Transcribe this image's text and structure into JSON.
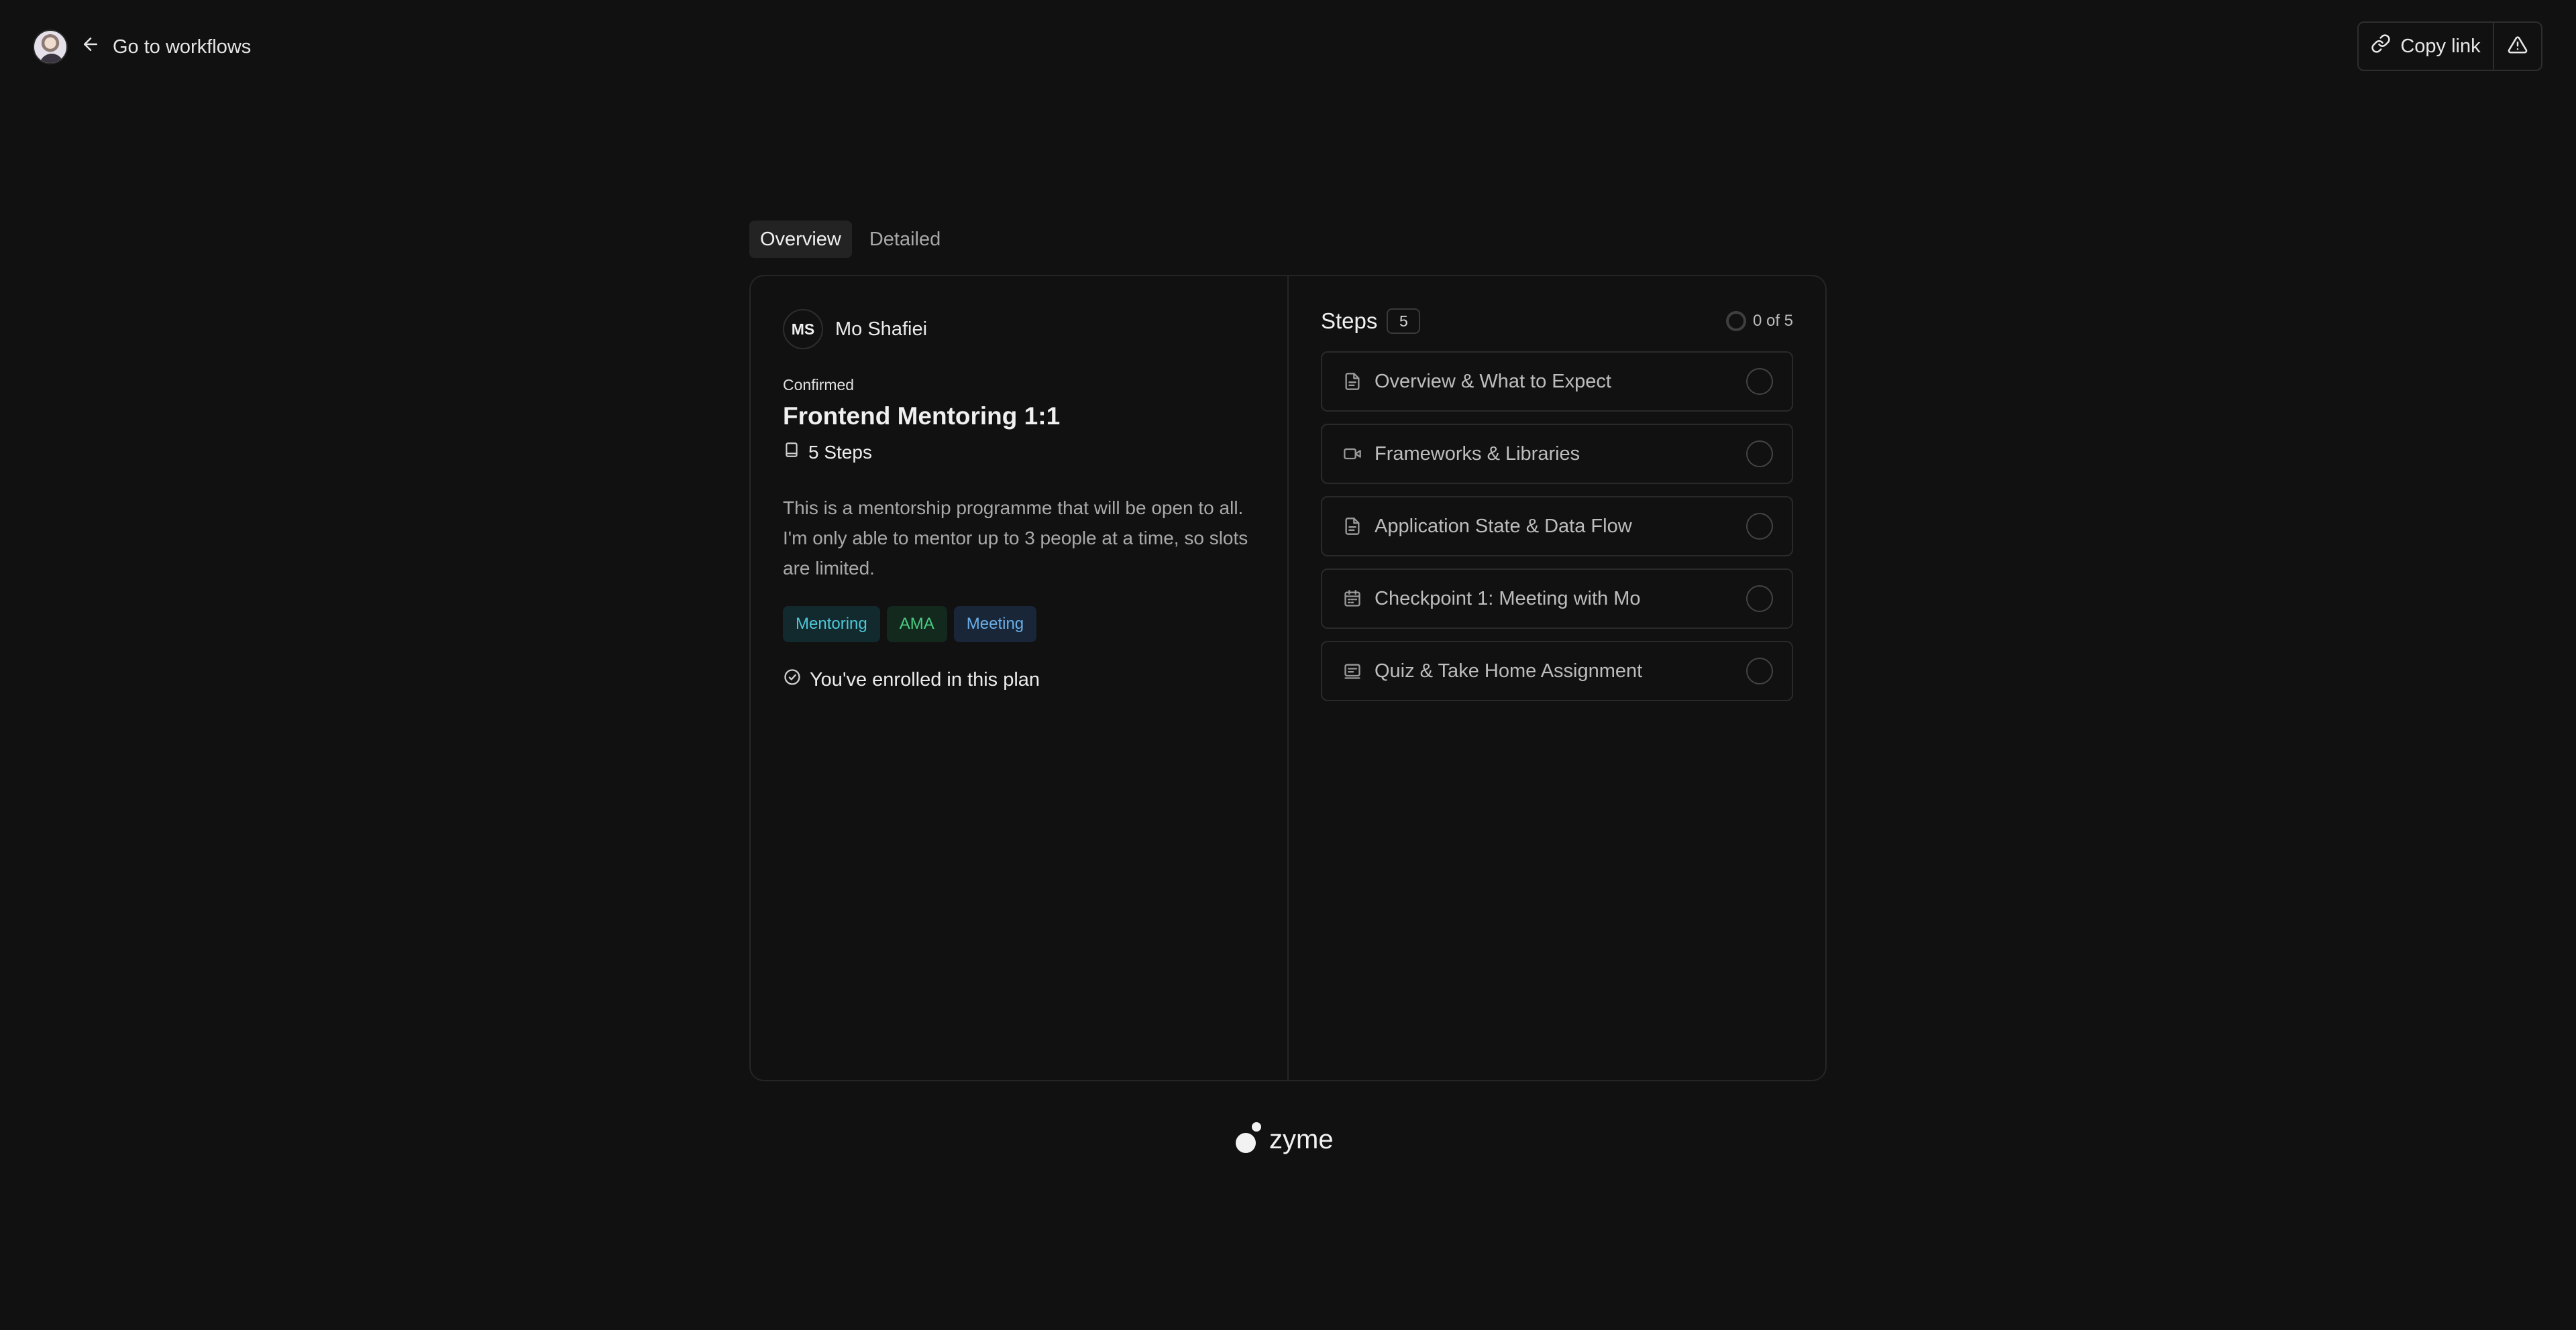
{
  "header": {
    "back_label": "Go to workflows",
    "copy_link_label": "Copy link"
  },
  "tabs": [
    {
      "label": "Overview",
      "active": true
    },
    {
      "label": "Detailed",
      "active": false
    }
  ],
  "plan": {
    "owner_initials": "MS",
    "owner_name": "Mo Shafiei",
    "status": "Confirmed",
    "title": "Frontend Mentoring 1:1",
    "steps_label": "5 Steps",
    "description": "This is a mentorship programme that will be open to all. I'm only able to mentor up to 3 people at a time, so slots are limited.",
    "tags": [
      {
        "label": "Mentoring",
        "color": "#4ec6d6"
      },
      {
        "label": "AMA",
        "color": "#49cf83"
      },
      {
        "label": "Meeting",
        "color": "#6aaee8"
      }
    ],
    "enrolled_label": "You've enrolled in this plan"
  },
  "steps_panel": {
    "title": "Steps",
    "count": "5",
    "progress": "0 of 5",
    "items": [
      {
        "label": "Overview & What to Expect",
        "icon": "document-icon"
      },
      {
        "label": "Frameworks & Libraries",
        "icon": "video-icon"
      },
      {
        "label": "Application State & Data Flow",
        "icon": "document-icon"
      },
      {
        "label": "Checkpoint 1: Meeting with Mo",
        "icon": "calendar-icon"
      },
      {
        "label": "Quiz & Take Home Assignment",
        "icon": "quiz-icon"
      }
    ]
  },
  "footer": {
    "logo_text": "zyme"
  }
}
